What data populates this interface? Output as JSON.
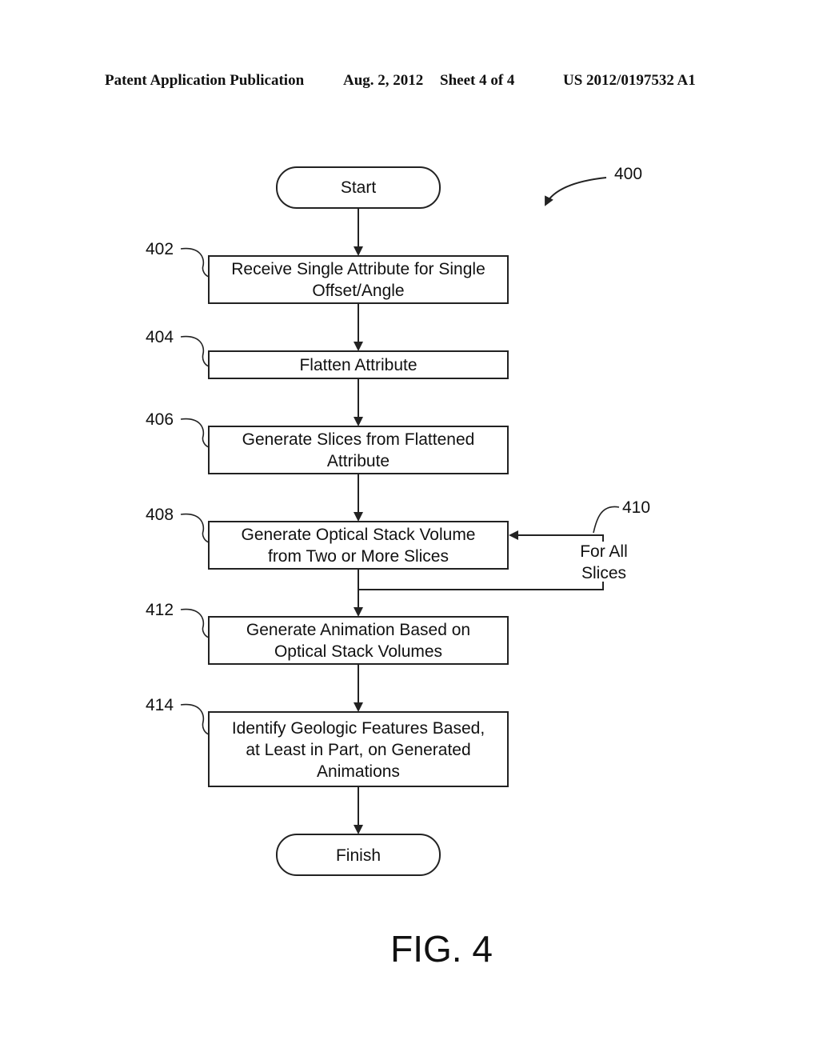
{
  "header": {
    "publication": "Patent Application Publication",
    "date": "Aug. 2, 2012",
    "sheet": "Sheet 4 of 4",
    "number": "US 2012/0197532 A1"
  },
  "figure": {
    "ref": "400",
    "caption": "FIG. 4"
  },
  "flowchart": {
    "start": "Start",
    "finish": "Finish",
    "steps": [
      {
        "ref": "402",
        "lines": [
          "Receive Single Attribute for Single",
          "Offset/Angle"
        ]
      },
      {
        "ref": "404",
        "lines": [
          "Flatten Attribute"
        ]
      },
      {
        "ref": "406",
        "lines": [
          "Generate Slices from Flattened",
          "Attribute"
        ]
      },
      {
        "ref": "408",
        "lines": [
          "Generate Optical Stack Volume",
          "from Two or More Slices"
        ]
      },
      {
        "ref": "412",
        "lines": [
          "Generate Animation Based on",
          "Optical Stack Volumes"
        ]
      },
      {
        "ref": "414",
        "lines": [
          "Identify Geologic Features Based,",
          "at Least in Part, on Generated",
          "Animations"
        ]
      }
    ],
    "loop": {
      "ref": "410",
      "lines": [
        "For All",
        "Slices"
      ]
    }
  }
}
